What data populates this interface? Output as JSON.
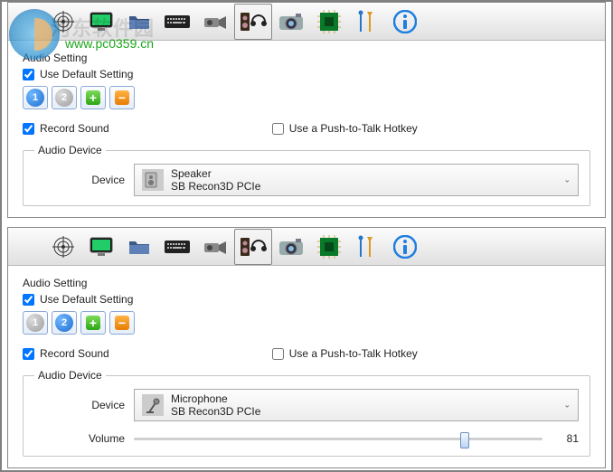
{
  "watermark": {
    "brand": "河东软件园",
    "url": "www.pc0359.cn"
  },
  "toolbar_icons": [
    "target-icon",
    "monitor-icon",
    "folder-icon",
    "keyboard-icon",
    "camcorder-icon",
    "speaker-headphone-icon",
    "camera-icon",
    "chip-icon",
    "tools-icon",
    "info-icon"
  ],
  "panel1": {
    "section_title": "Audio Setting",
    "use_default_label": "Use Default Setting",
    "use_default_checked": true,
    "active_slot": 1,
    "slot_labels": [
      "1",
      "2"
    ],
    "record_label": "Record Sound",
    "record_checked": true,
    "ptt_label": "Use a Push-to-Talk Hotkey",
    "ptt_checked": false,
    "device_group": "Audio Device",
    "device_label": "Device",
    "device_name": "Speaker",
    "device_sub": "SB Recon3D PCIe",
    "selected_tab": 5
  },
  "panel2": {
    "section_title": "Audio Setting",
    "use_default_label": "Use Default Setting",
    "use_default_checked": true,
    "active_slot": 2,
    "slot_labels": [
      "1",
      "2"
    ],
    "record_label": "Record Sound",
    "record_checked": true,
    "ptt_label": "Use a Push-to-Talk Hotkey",
    "ptt_checked": false,
    "device_group": "Audio Device",
    "device_label": "Device",
    "device_name": "Microphone",
    "device_sub": "SB Recon3D PCIe",
    "volume_label": "Volume",
    "volume_value": 81,
    "volume_min": 0,
    "volume_max": 100,
    "selected_tab": 5
  }
}
